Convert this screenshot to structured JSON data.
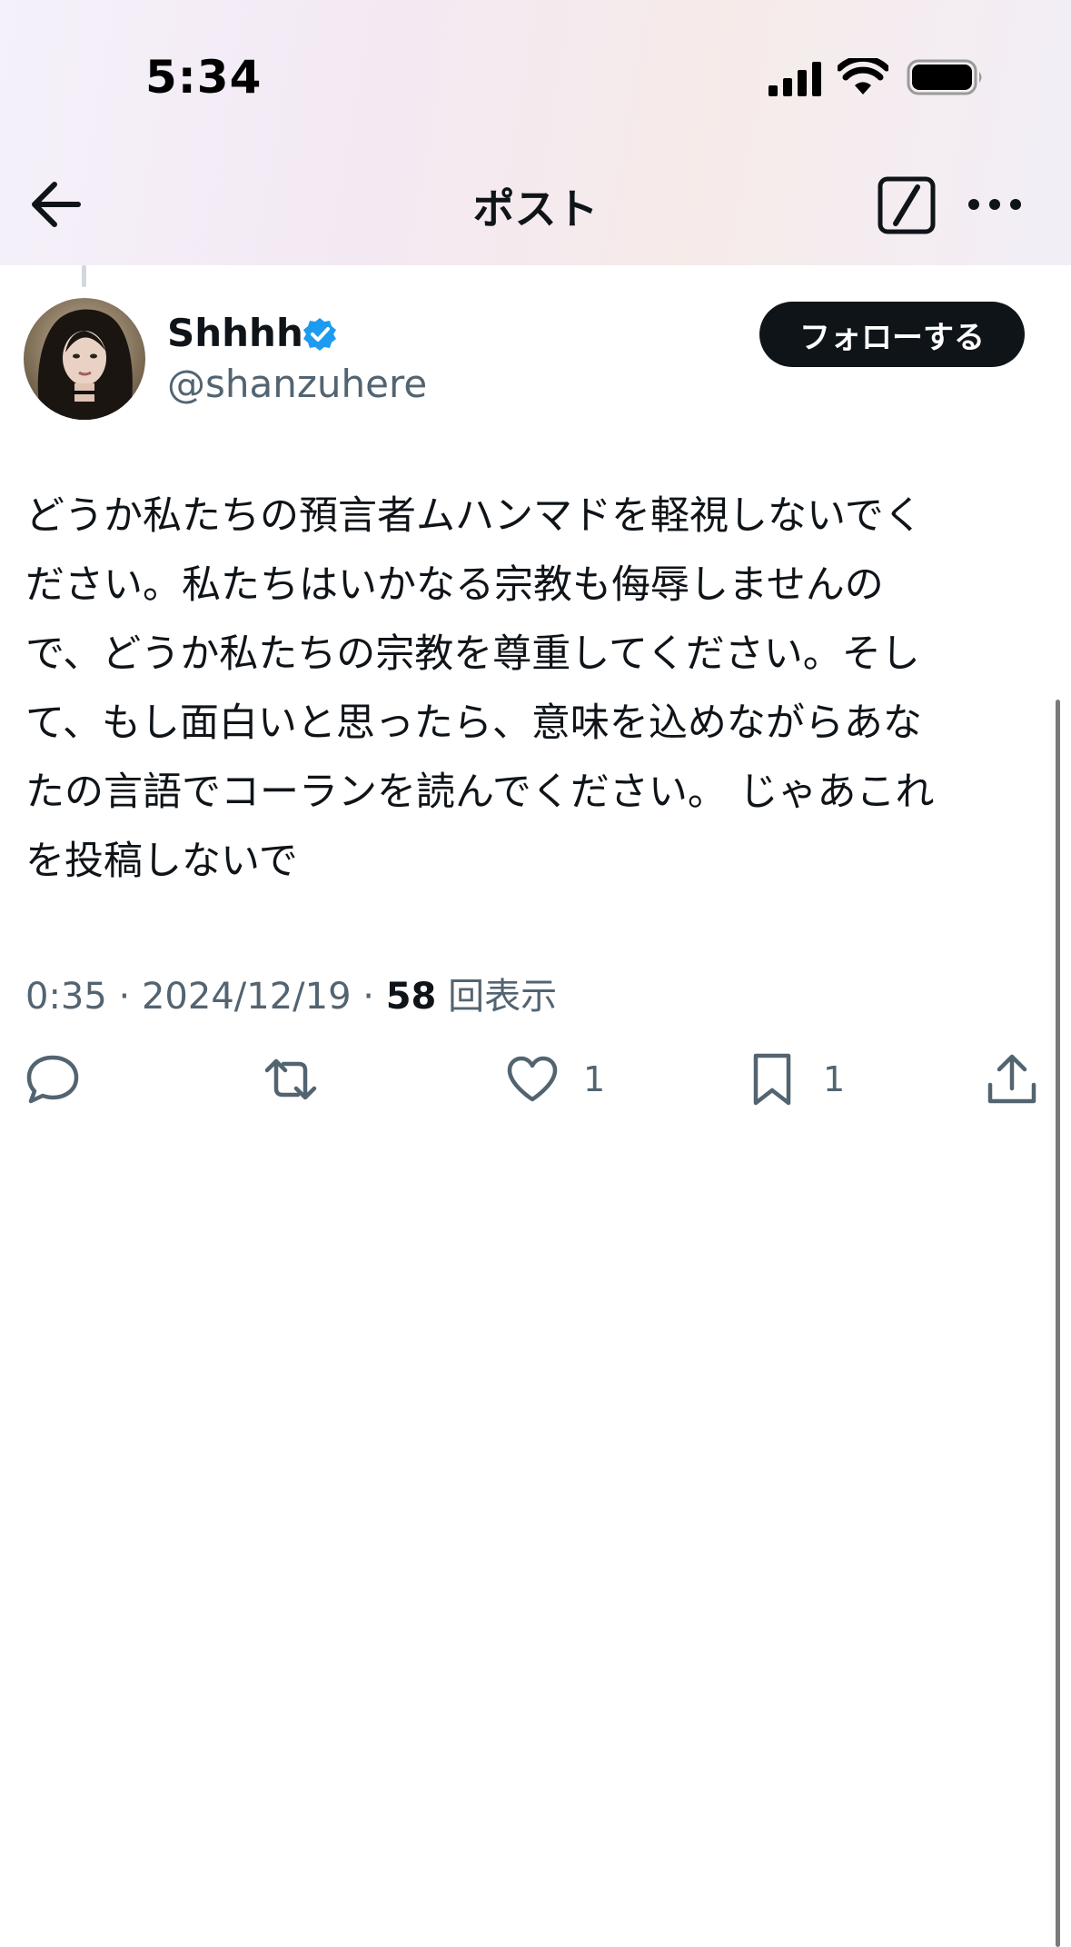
{
  "status_bar": {
    "time": "5:34"
  },
  "nav": {
    "title": "ポスト",
    "back_icon": "back-arrow-icon",
    "grok_icon": "grok-icon",
    "more_icon": "more-icon"
  },
  "author": {
    "name": "Shhhh",
    "handle": "@shanzuhere",
    "verified": true,
    "follow_label": "フォローする"
  },
  "tweet": {
    "text": "どうか私たちの預言者ムハンマドを軽視しないでく\nださい。私たちはいかなる宗教も侮辱しませんの\nで、どうか私たちの宗教を尊重してください。そし\nて、もし面白いと思ったら、意味を込めながらあな\nたの言語でコーランを読んでください。 じゃあこれ\nを投稿しないで",
    "time": "0:35",
    "sep1": " · ",
    "date": "2024/12/19",
    "sep2": " · ",
    "views_count": "58",
    "views_label": " 回表示"
  },
  "actions": {
    "reply_icon": "reply-icon",
    "retweet_icon": "retweet-icon",
    "like_icon": "heart-icon",
    "like_count": "1",
    "bookmark_icon": "bookmark-icon",
    "bookmark_count": "1",
    "share_icon": "share-icon"
  },
  "colors": {
    "text_primary": "#0f1419",
    "text_secondary": "#536471",
    "verified_blue": "#1d9bf0",
    "button_bg": "#0f1419"
  }
}
